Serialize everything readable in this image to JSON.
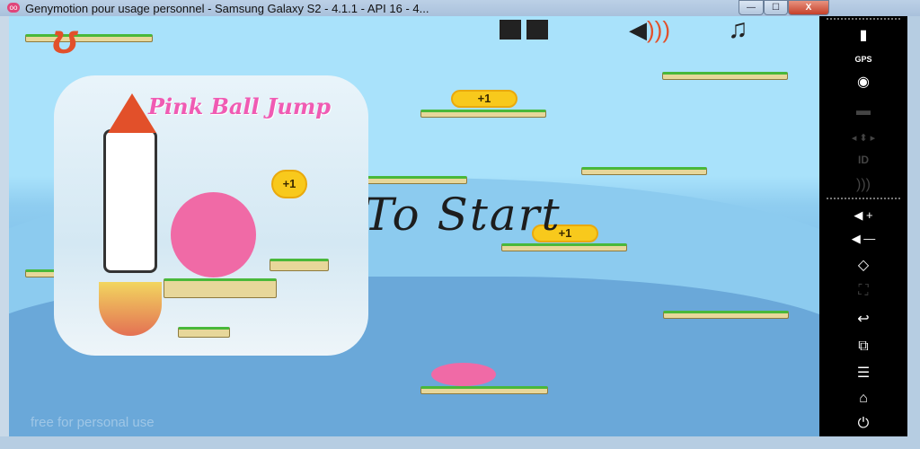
{
  "window": {
    "title": "Genymotion pour usage personnel - Samsung Galaxy S2 - 4.1.1 - API 16 - 4...",
    "minimize": "—",
    "maximize": "☐",
    "close": "X"
  },
  "game": {
    "tap_to_start": "To Start",
    "coins": [
      "+1",
      "+1",
      "+1"
    ],
    "overlay_title": "Pink Ball Jump",
    "overlay_coin": "+1",
    "watermark": "free for personal use"
  },
  "sidebar": {
    "items": [
      {
        "name": "battery",
        "glyph": "▮"
      },
      {
        "name": "gps",
        "glyph": "GPS"
      },
      {
        "name": "webcam",
        "glyph": "◉"
      },
      {
        "name": "screencast",
        "glyph": "▬"
      },
      {
        "name": "remote-control",
        "glyph": "◂ ⬍ ▸"
      },
      {
        "name": "id",
        "glyph": "ID"
      },
      {
        "name": "rss",
        "glyph": ")))"
      },
      {
        "name": "volume-up",
        "glyph": "◀ +"
      },
      {
        "name": "volume-down",
        "glyph": "◀ —"
      },
      {
        "name": "rotate",
        "glyph": "◇"
      },
      {
        "name": "scale",
        "glyph": "⛶"
      },
      {
        "name": "back",
        "glyph": "↩"
      },
      {
        "name": "recent-apps",
        "glyph": "⧉"
      },
      {
        "name": "menu",
        "glyph": "☰"
      },
      {
        "name": "home",
        "glyph": "⌂"
      },
      {
        "name": "power",
        "glyph": "⏻"
      }
    ]
  }
}
